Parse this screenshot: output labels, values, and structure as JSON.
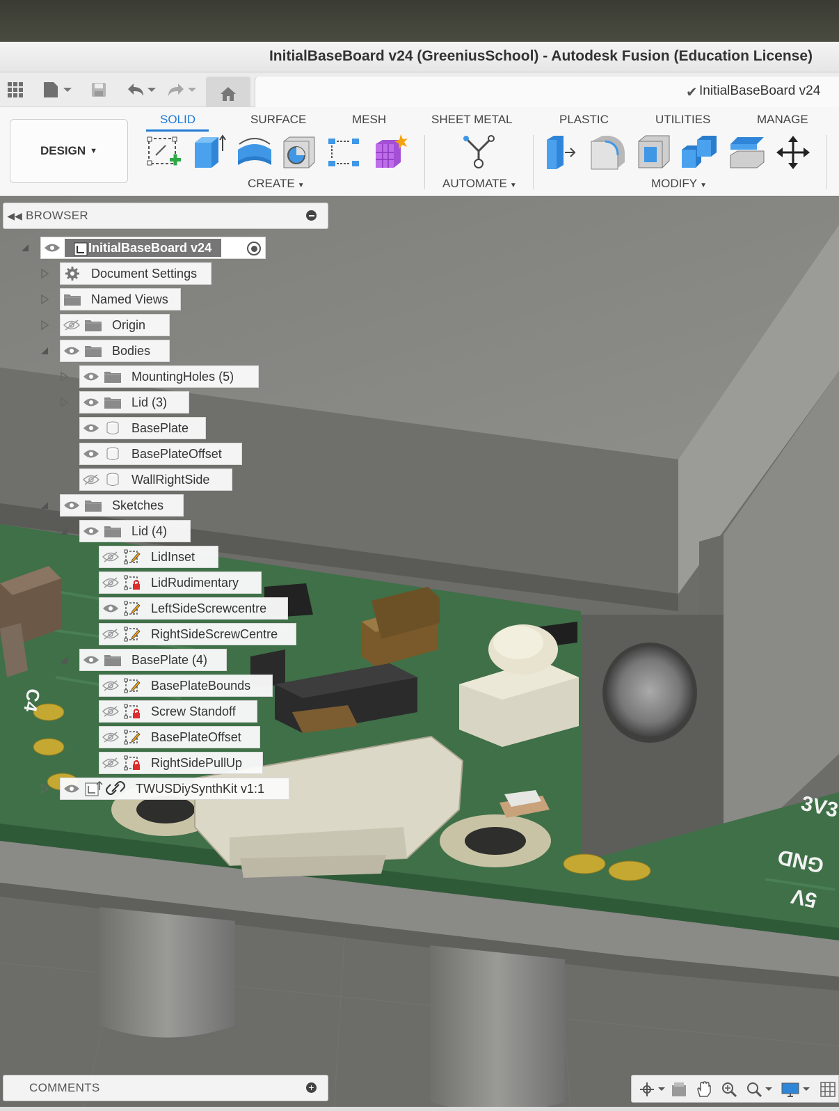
{
  "window": {
    "title": "InitialBaseBoard v24 (GreeniusSchool) - Autodesk Fusion (Education License)"
  },
  "document_tab": {
    "label": "InitialBaseBoard v24",
    "saved": true
  },
  "workspace": {
    "label": "DESIGN"
  },
  "ribbon": {
    "tabs": [
      "SOLID",
      "SURFACE",
      "MESH",
      "SHEET METAL",
      "PLASTIC",
      "UTILITIES",
      "MANAGE"
    ],
    "active_tab": "SOLID",
    "groups": {
      "create": "CREATE",
      "automate": "AUTOMATE",
      "modify": "MODIFY"
    },
    "create_tools": [
      "create-sketch",
      "extrude",
      "revolve",
      "hole",
      "pattern",
      "form"
    ],
    "automate_tools": [
      "automate"
    ],
    "modify_tools": [
      "press-pull",
      "fillet",
      "shell",
      "combine",
      "offset-face",
      "move"
    ]
  },
  "browser": {
    "title": "BROWSER",
    "root": {
      "label": "InitialBaseBoard v24",
      "expanded": true,
      "visible": true,
      "active": true
    },
    "items": [
      {
        "label": "Document Settings",
        "icon": "gear-icon",
        "expand": "collapsed",
        "eye": "none"
      },
      {
        "label": "Named Views",
        "icon": "folder-icon",
        "expand": "collapsed",
        "eye": "none"
      },
      {
        "label": "Origin",
        "icon": "folder-icon",
        "expand": "collapsed",
        "eye": "hidden"
      },
      {
        "label": "Bodies",
        "icon": "folder-icon",
        "expand": "expanded",
        "eye": "visible"
      },
      {
        "label": "MountingHoles (5)",
        "icon": "folder-icon",
        "expand": "collapsed",
        "eye": "visible"
      },
      {
        "label": "Lid (3)",
        "icon": "folder-icon",
        "expand": "collapsed",
        "eye": "visible"
      },
      {
        "label": "BasePlate",
        "icon": "body-icon",
        "expand": "none",
        "eye": "visible"
      },
      {
        "label": "BasePlateOffset",
        "icon": "body-icon",
        "expand": "none",
        "eye": "visible"
      },
      {
        "label": "WallRightSide",
        "icon": "body-icon",
        "expand": "none",
        "eye": "hidden"
      },
      {
        "label": "Sketches",
        "icon": "folder-icon",
        "expand": "expanded",
        "eye": "visible"
      },
      {
        "label": "Lid (4)",
        "icon": "folder-icon",
        "expand": "expanded",
        "eye": "visible"
      },
      {
        "label": "LidInset",
        "icon": "sketch-icon",
        "expand": "none",
        "eye": "hidden"
      },
      {
        "label": "LidRudimentary",
        "icon": "sketch-locked-icon",
        "expand": "none",
        "eye": "hidden"
      },
      {
        "label": "LeftSideScrewcentre",
        "icon": "sketch-icon",
        "expand": "none",
        "eye": "visible"
      },
      {
        "label": "RightSideScrewCentre",
        "icon": "sketch-icon",
        "expand": "none",
        "eye": "hidden"
      },
      {
        "label": "BasePlate (4)",
        "icon": "folder-icon",
        "expand": "expanded",
        "eye": "visible"
      },
      {
        "label": "BasePlateBounds",
        "icon": "sketch-icon",
        "expand": "none",
        "eye": "hidden"
      },
      {
        "label": "Screw Standoff",
        "icon": "sketch-locked-icon",
        "expand": "none",
        "eye": "hidden"
      },
      {
        "label": "BasePlateOffset",
        "icon": "sketch-icon",
        "expand": "none",
        "eye": "hidden"
      },
      {
        "label": "RightSidePullUp",
        "icon": "sketch-locked-icon",
        "expand": "none",
        "eye": "hidden"
      },
      {
        "label": "TWUSDiySynthKit v1:1",
        "icon": "linked-component-icon",
        "expand": "collapsed",
        "eye": "visible"
      }
    ]
  },
  "comments": {
    "title": "COMMENTS"
  },
  "pcb_silkscreen": [
    "3V3",
    "GND",
    "5V",
    "C4"
  ],
  "colors": {
    "accent": "#1e7bd6",
    "pcb_green": "#3c6b45",
    "enclosure_grey": "#8f8f8c"
  }
}
